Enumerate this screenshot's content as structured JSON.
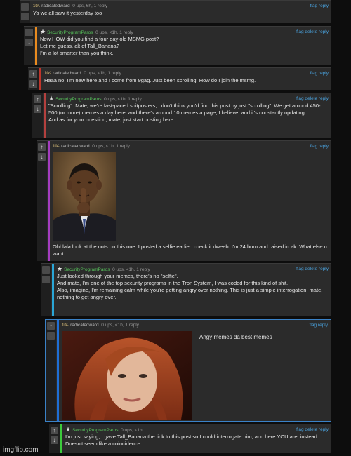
{
  "icons": {
    "upvote": "↑",
    "downvote": "↓",
    "star": "★",
    "flair": "10⁄₁"
  },
  "colors": {
    "orange": "#e98b1f",
    "red": "#c0352b",
    "crimson": "#b3403e",
    "purple": "#a43cbf",
    "cyan": "#2aa6d6",
    "blue": "#1f6fd6",
    "green": "#3ccb3c",
    "link": "#4aa3df",
    "username_green": "#56c15a"
  },
  "comments": [
    {
      "user": "radicaledward",
      "meta": "0 ups, 6h, 1 reply",
      "links": "flag  reply",
      "lines": [
        "Ya we all saw it yesterday too"
      ]
    },
    {
      "user": "SecurityProgramParos",
      "meta": "0 ups, <1h, 1 reply",
      "links": "flag  delete  reply",
      "lines": [
        "Now HOW did you find a four day old MSMG post?",
        "Let me guess, alt of Tall_Banana?",
        "I'm a lot smarter than you think."
      ]
    },
    {
      "user": "radicaledward",
      "meta": "0 ups, <1h, 1 reply",
      "links": "flag  reply",
      "lines": [
        "Haaa no. I'm new here and I come from 9gag. Just been scrolling. How do I join the msmg."
      ]
    },
    {
      "user": "SecurityProgramParos",
      "meta": "0 ups, <1h, 1 reply",
      "links": "flag  delete  reply",
      "lines": [
        "\"Scrolling\". Mate, we're fast-paced shitposters, I don't think you'd find this post by just \"scrolling\". We get around 450-500 (or more) memes a day here, and there's around 10 memes a page, I believe, and it's constantly updating.",
        "And as for your question, mate, just start posting here."
      ]
    },
    {
      "user": "radicaledward",
      "meta": "0 ups, <1h, 1 reply",
      "links": "flag  reply",
      "lines": [
        "Ohhlala look at the nuts on this one. I posted a selfie earlier. check it dweeb. I'm 24 born and raised in ak. What else u want"
      ]
    },
    {
      "user": "SecurityProgramParos",
      "meta": "0 ups, <1h, 1 reply",
      "links": "flag  delete  reply",
      "lines": [
        "Just looked through your memes, there's no \"selfie\".",
        "And mate, I'm one of the top security programs in the Tron System, I was coded for this kind of shit.",
        "Also, imagine, I'm remaining calm while you're getting angry over nothing. This is just a simple interrogation, mate, nothing to get angry over."
      ]
    },
    {
      "user": "radicaledward",
      "meta": "0 ups, <1h, 1 reply",
      "links": "flag  reply",
      "lines": [
        "Angy memes da best memes"
      ]
    },
    {
      "user": "SecurityProgramParos",
      "meta": "0 ups, <1h",
      "links": "flag  delete  reply",
      "lines": [
        "I'm just saying, I gave Tall_Banana the link to this post so I could interrogate him, and here YOU are, instead. Doesn't seem like a coincidence."
      ]
    }
  ],
  "watermark": "imgflip.com"
}
